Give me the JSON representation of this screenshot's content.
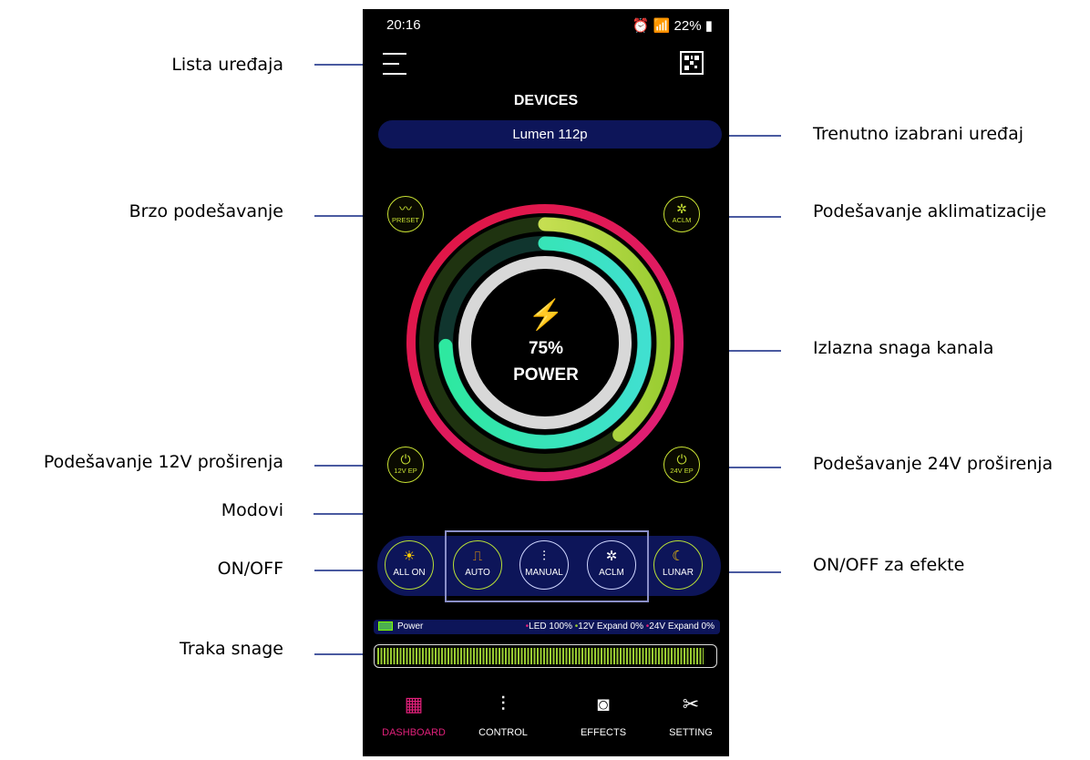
{
  "annotations": {
    "device_list": "Lista uređaja",
    "current_device": "Trenutno izabrani uređaj",
    "quick_setup": "Brzo podešavanje",
    "acclimatization": "Podešavanje aklimatizacije",
    "channel_output": "Izlazna snaga kanala",
    "ext12": "Podešavanje 12V proširenja",
    "ext24": "Podešavanje 24V proširenja",
    "modes": "Modovi",
    "onoff": "ON/OFF",
    "onoff_effects": "ON/OFF za efekte",
    "power_bar": "Traka snage"
  },
  "status": {
    "time": "20:16",
    "battery": "22%"
  },
  "header": {
    "title": "DEVICES",
    "device": "Lumen 112p"
  },
  "corner_buttons": {
    "preset": "PRESET",
    "aclm": "ACLM",
    "ep12": "12V EP",
    "ep24": "24V EP"
  },
  "power_ring": {
    "percent": "75%",
    "label": "POWER"
  },
  "modes": {
    "all_on": "ALL ON",
    "auto": "AUTO",
    "manual": "MANUAL",
    "aclm": "ACLM",
    "lunar": "LUNAR"
  },
  "power_row": {
    "label": "Power",
    "led": "LED 100%",
    "ext12": "12V Expand 0%",
    "ext24": "24V Expand 0%"
  },
  "power_level": 0.97,
  "nav": {
    "dashboard": "DASHBOARD",
    "control": "CONTROL",
    "effects": "EFFECTS",
    "setting": "SETTING"
  },
  "icons": [
    "menu-icon",
    "qr-icon",
    "pulse-icon",
    "coral-icon",
    "plug-icon",
    "bolt-icon",
    "sun-icon",
    "curve-icon",
    "sliders-icon",
    "moon-icon",
    "battery-icon",
    "grid-icon",
    "wrench-icon",
    "bulb-icon"
  ],
  "colors": {
    "accent_green": "#c7e033",
    "panel_navy": "#0d1559",
    "active_pink": "#e0207a"
  }
}
